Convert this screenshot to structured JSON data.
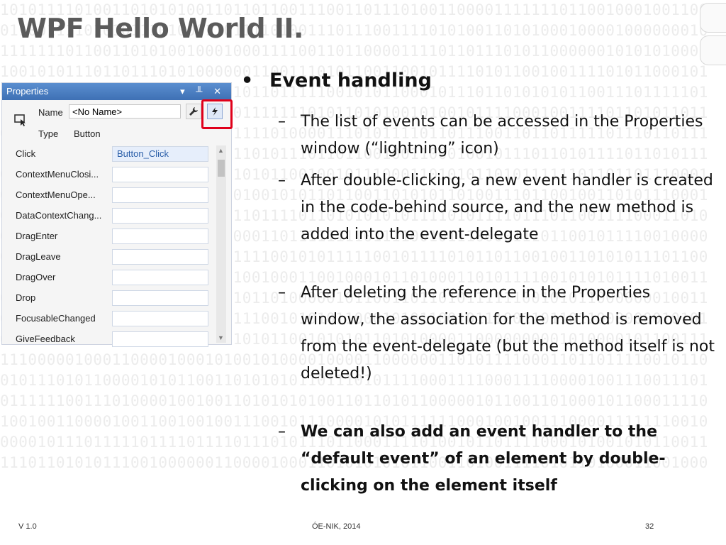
{
  "slide": {
    "title": "WPF Hello World II.",
    "version": "V 1.0",
    "footer_center": "ÓE-NIK, 2014",
    "page_number": "32"
  },
  "background_binary": [
    "1010111101001101010100110110110011100110111010011000011111110110010001001100",
    "0110011110101011101000110111101001110111001111010100110101000100001000000010",
    "1111111011001101010010001000111100110110000111101101110101100000010101010001",
    "1001010111011011101010000001100111010110011001011110101100100111101011000101",
    "0110111100100101101000100101101111100101011000101110110101010110011101111101",
    "1000111011010001101110010011111110101101010010100101111000100111101101011011",
    "0111110101001001100100110111101000011101011110110111001101101111101110110111",
    "1001101101011111011101000110101110110110010011000100101110110101111011010111",
    "0101100001101010100001101101011001001011100011010101101011111101101101110001",
    "0001100011101001100111010010010101101100110101011010011101100100110101110001",
    "0001000110100011001111000110111101101010101011110101111011101100111100011010",
    "0001011110101001100100011000110111111110111100101110000111011001011110010000",
    "0010110110011001101101010111100101011111001011110101101100100110101011101100",
    "1101011000010101010101011100100011001000101101000110101111001010101111010011",
    "0101100100101010111001000101101000001011001101101011111100101011000000010011",
    "0111110011000011101100010111001010101100010101100101110011011011000000010101",
    "0110000100101101000011010101011001010101101010000110000000001010000101100111",
    "1110000010001100001000101001010000100001100000011010111100011011011110010110",
    "0101110101100001010110011010101011011101011110001111000111100001001110011101",
    "0111111001110100001001001101010101001101101011000001011001101000101100011110",
    "1001001100001001100100100111001011100001010111111000100100111000011111110010",
    "0000101110111110111101111011101011101100011110100101101111000101001010110011",
    "1110110101011100100000011000010001101010101011001101001111010110100011001000"
  ],
  "properties_panel": {
    "title": "Properties",
    "titlebar_icons": "▾ ╨ ✕",
    "name_label": "Name",
    "name_value": "<No Name>",
    "type_label": "Type",
    "type_value": "Button",
    "events": [
      {
        "name": "Click",
        "handler": "Button_Click"
      },
      {
        "name": "ContextMenuClosi...",
        "handler": ""
      },
      {
        "name": "ContextMenuOpe...",
        "handler": ""
      },
      {
        "name": "DataContextChang...",
        "handler": ""
      },
      {
        "name": "DragEnter",
        "handler": ""
      },
      {
        "name": "DragLeave",
        "handler": ""
      },
      {
        "name": "DragOver",
        "handler": ""
      },
      {
        "name": "Drop",
        "handler": ""
      },
      {
        "name": "FocusableChanged",
        "handler": ""
      },
      {
        "name": "GiveFeedback",
        "handler": ""
      }
    ],
    "highlight_color": "#e0001a",
    "titlebar_color": "#4f81bd"
  },
  "content": {
    "heading_bullet": "•",
    "heading": "Event handling",
    "dash": "–",
    "items": [
      {
        "text": "The list of events can be accessed in the Properties window (“lightning” icon)",
        "bold": false
      },
      {
        "text": "After double-clicking, a new event handler is created in the code-behind source, and the new method is added into the event-delegate",
        "bold": false
      },
      {
        "text": "After deleting the reference in the Properties window, the association for the method is removed from the event-delegate (but the method itself is not deleted!)",
        "bold": false
      },
      {
        "text": "We can also add an event handler to the “default event” of an element by double-clicking on the element itself",
        "bold": true
      }
    ]
  }
}
